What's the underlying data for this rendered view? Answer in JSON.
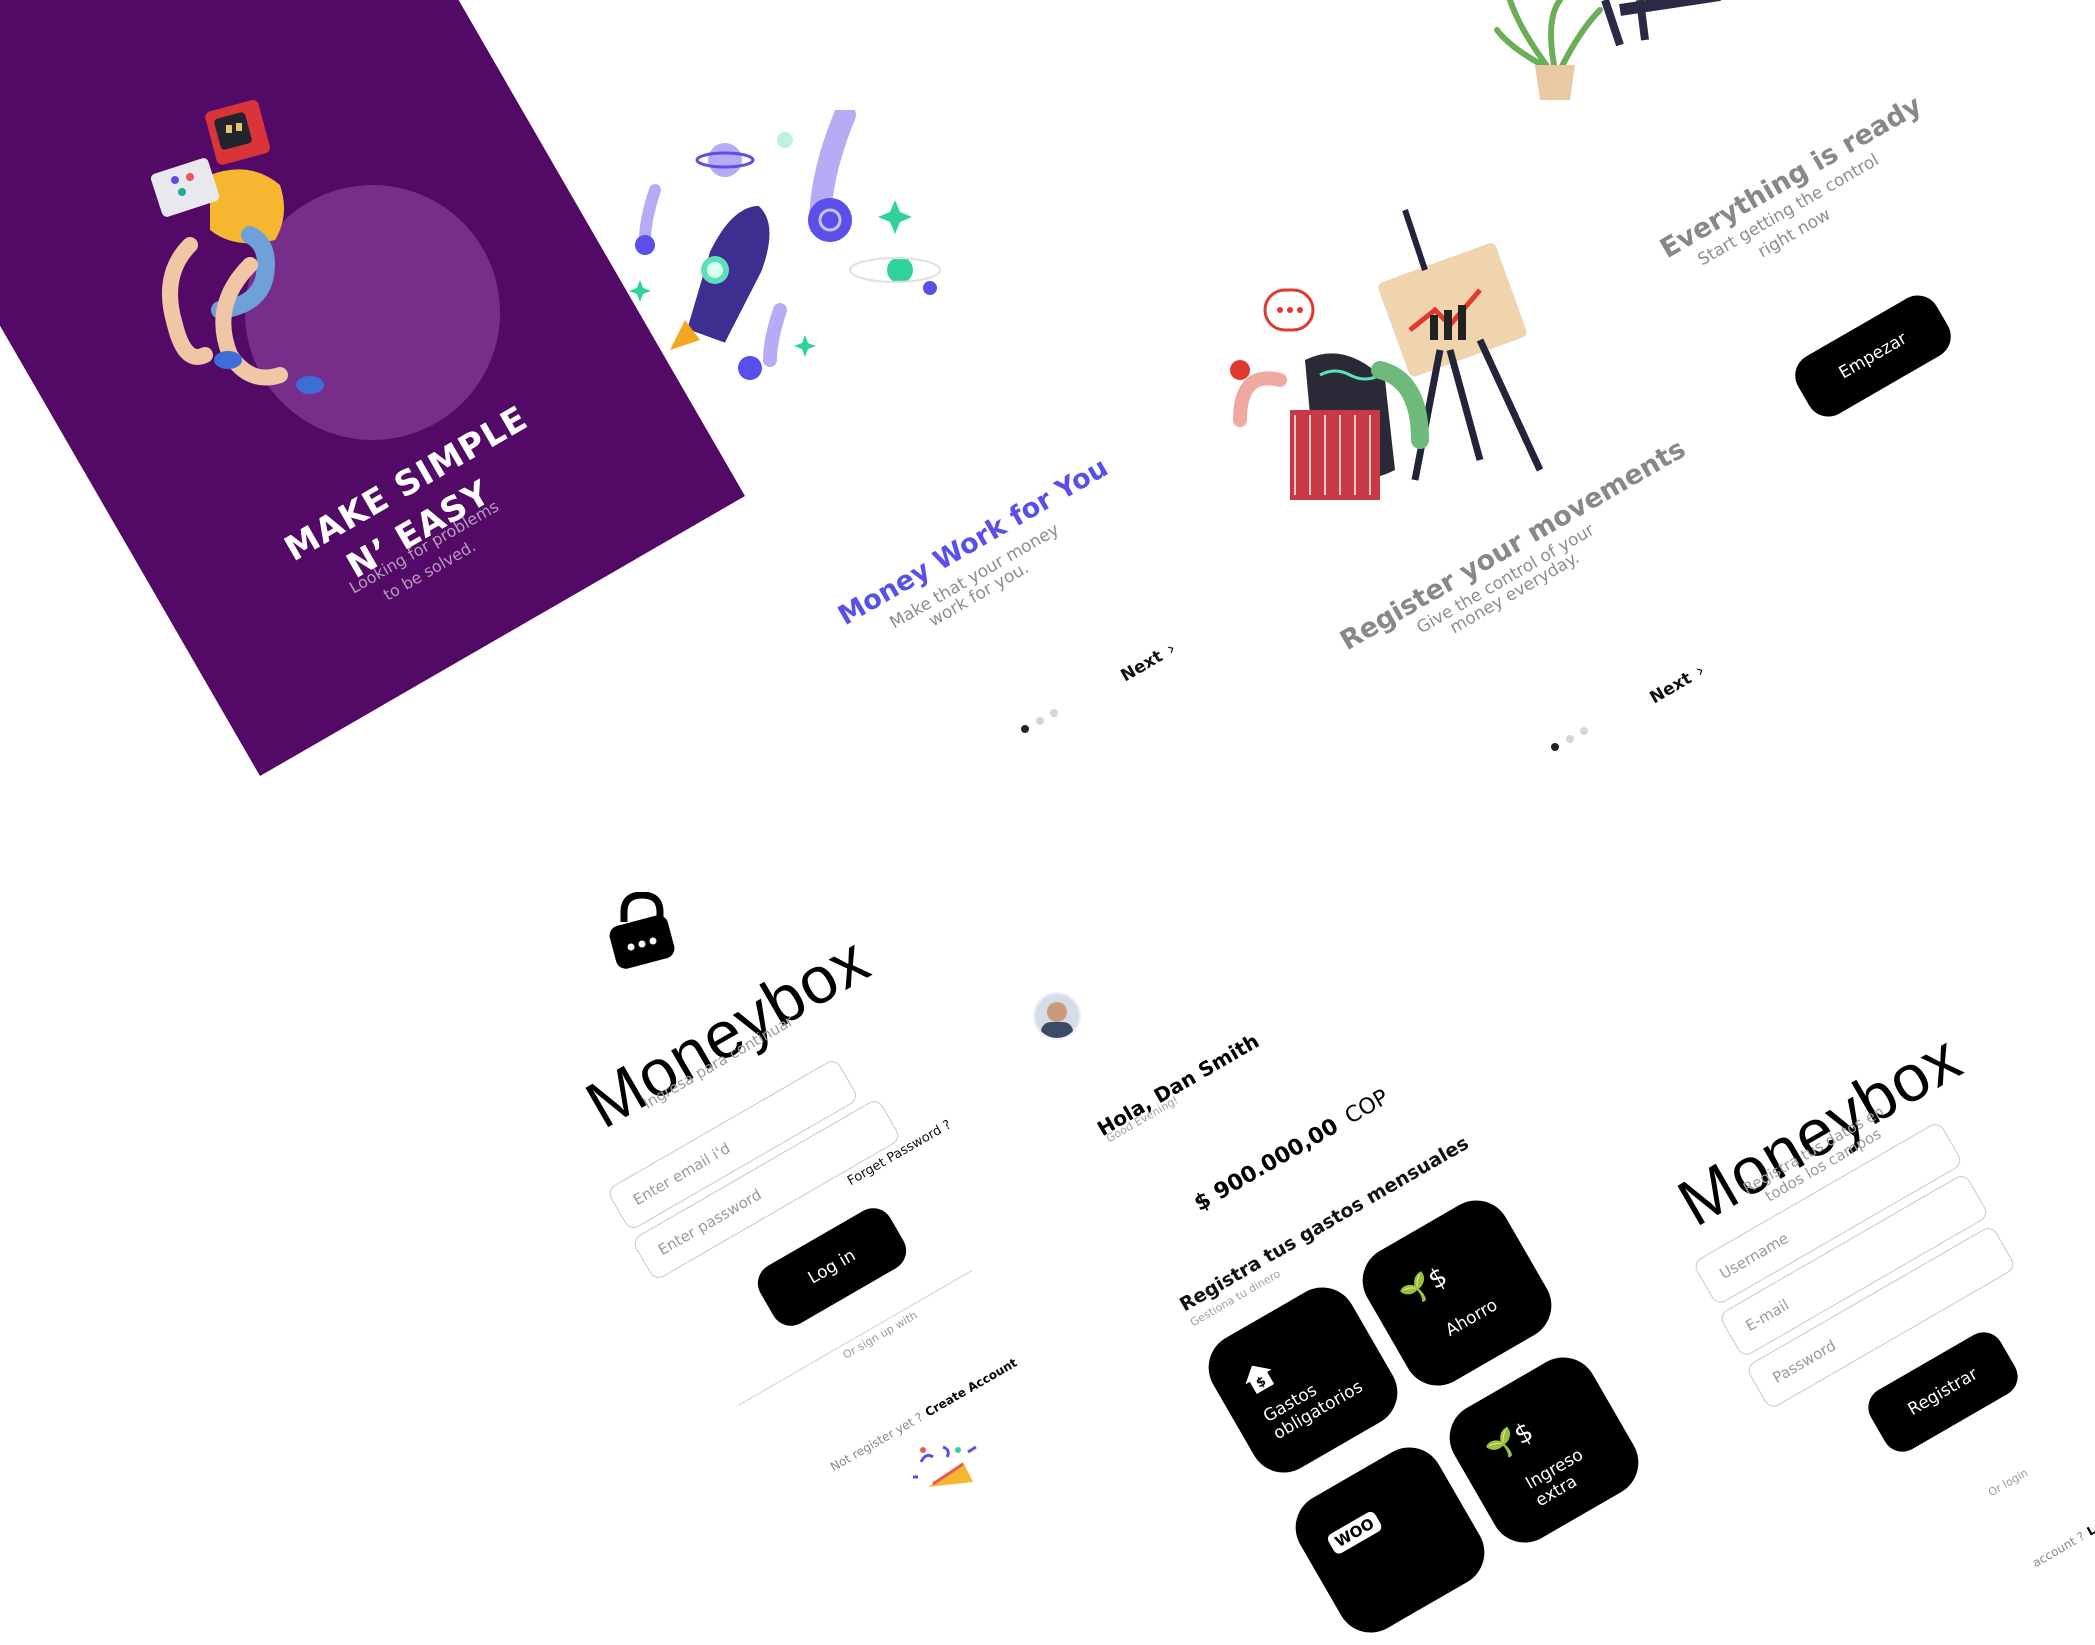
{
  "splash": {
    "title_line1": "MAKE SIMPLE",
    "title_line2": "N’ EASY",
    "subtitle_line1": "Looking for problems",
    "subtitle_line2": "to be solved.",
    "background": "#530a66"
  },
  "onboarding1": {
    "title": "Money Work for You",
    "subtitle_line1": "Make that your money",
    "subtitle_line2": "work for you.",
    "next_label": "Next",
    "chevron_icon": "chevron-right-icon",
    "accent": "#5a4fe8"
  },
  "onboarding2": {
    "title": "Register your movements",
    "subtitle_line1": "Give the control of your",
    "subtitle_line2": "money everyday.",
    "next_label": "Next"
  },
  "onboarding3": {
    "title": "Everything is ready",
    "subtitle_line1": "Start getting the control",
    "subtitle_line2": "right now",
    "button_label": "Empezar"
  },
  "login": {
    "lock_icon": "lock-icon",
    "brand": "Moneybox",
    "tagline": "Ingresa para continuar",
    "email_placeholder": "Enter email i'd",
    "password_placeholder": "Enter password",
    "forget_label": "Forget Password ?",
    "login_label": "Log in",
    "or_label": "Or sign up with",
    "not_registered": "Not register yet ?",
    "create_label": "Create Account"
  },
  "dashboard": {
    "greeting": "Hola, Dan Smith",
    "greeting_sub": "Good Evening!",
    "balance": "$ 900.000,00",
    "currency": "COP",
    "section_title": "Registra tus gastos mensuales",
    "section_sub": "Gestiona tu dinero",
    "cards": [
      {
        "label": "Ahorro",
        "icon": "plant-money-icon"
      },
      {
        "label_line1": "Gastos",
        "label_line2": "obligatorios",
        "icon": "house-dollar-icon"
      },
      {
        "label_line1": "Ingreso",
        "label_line2": "extra",
        "icon": "plant-money-icon"
      },
      {
        "label": "WOO",
        "icon": "woo-badge-icon"
      }
    ]
  },
  "register": {
    "brand": "Moneybox",
    "tagline_line1": "Registra tus datos en",
    "tagline_line2": "todos los campos",
    "username_placeholder": "Username",
    "email_placeholder": "E-mail",
    "password_placeholder": "Password",
    "button_label": "Registrar",
    "or_label": "Or login",
    "account_prefix": "account ?",
    "login_link": "Log in"
  }
}
